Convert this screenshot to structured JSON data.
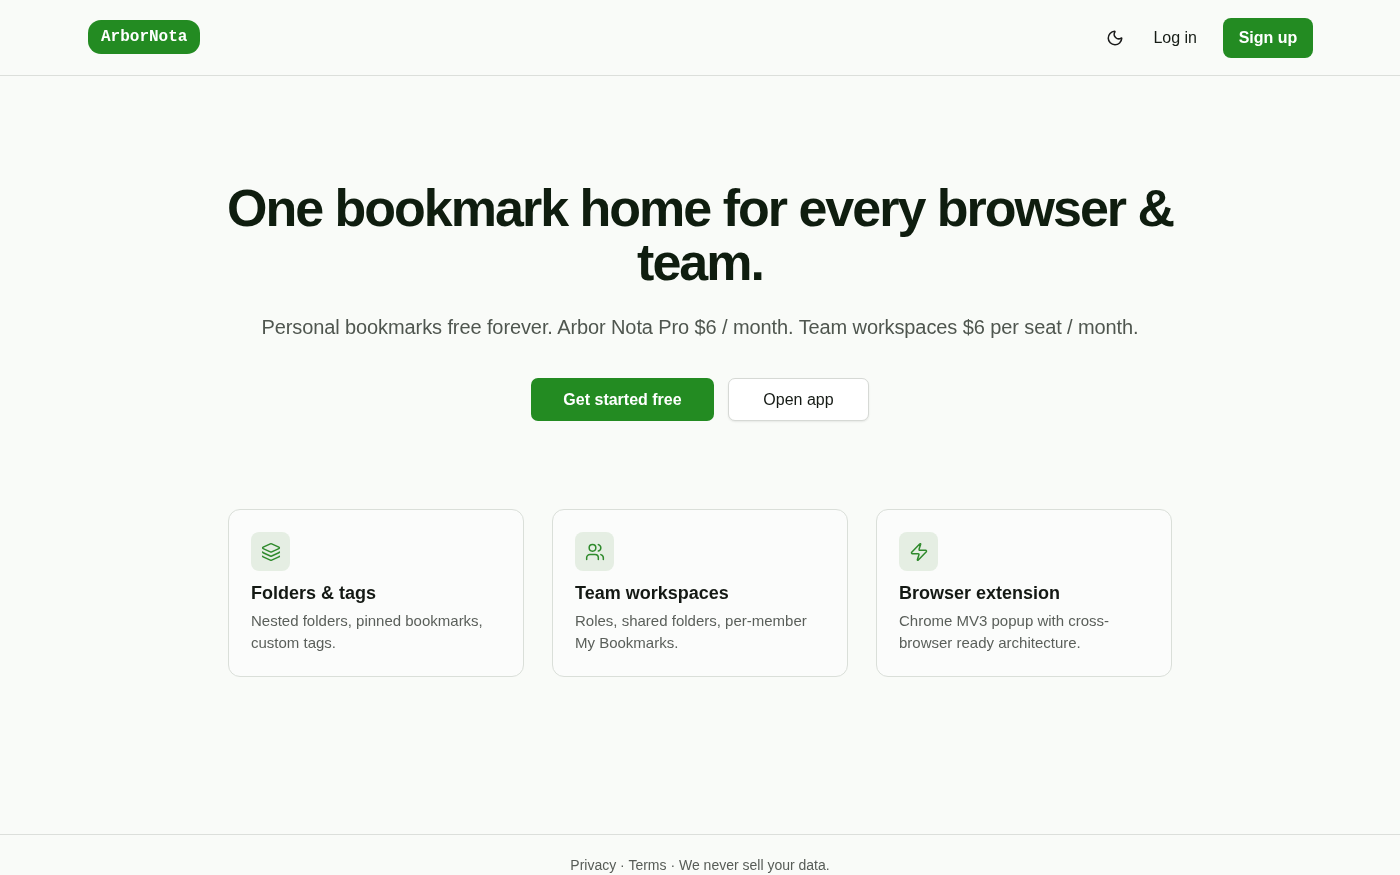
{
  "header": {
    "logo": "ArborNota",
    "login": "Log in",
    "signup": "Sign up"
  },
  "hero": {
    "title": "One bookmark home for every browser & team.",
    "subtitle": "Personal bookmarks free forever. Arbor Nota Pro $6 / month. Team workspaces $6 per seat / month.",
    "buttons": [
      {
        "label": "Get started free",
        "kind": "primary"
      },
      {
        "label": "Open app",
        "kind": "secondary"
      }
    ]
  },
  "features": [
    {
      "title": "Folders & tags",
      "description": "Nested folders, pinned bookmarks, custom tags."
    },
    {
      "title": "Team workspaces",
      "description": "Roles, shared folders, per-member My Bookmarks."
    },
    {
      "title": "Browser extension",
      "description": "Chrome MV3 popup with cross-browser ready architecture."
    }
  ],
  "footer": {
    "links": [
      "Privacy",
      "Terms"
    ],
    "separator": "·",
    "note": "We never sell your data."
  }
}
